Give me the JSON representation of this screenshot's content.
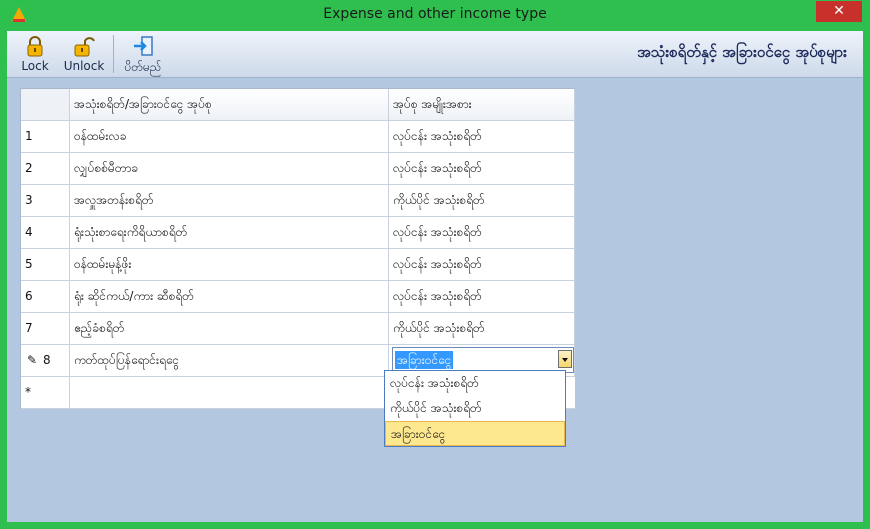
{
  "window": {
    "title": "Expense and other income type",
    "close_glyph": "✕"
  },
  "toolbar": {
    "lock_label": "Lock",
    "unlock_label": "Unlock",
    "close_label": "ပိတ်မည်"
  },
  "page_title": "အသုံးစရိတ်နှင့် အခြားဝင်ငွေ အုပ်စုများ",
  "grid": {
    "columns": [
      "အသုံးစရိတ်/အခြားဝင်ငွေ အုပ်စု",
      "အုပ်စု အမျိုးအစား"
    ],
    "rows": [
      {
        "no": "1",
        "name": "ဝန်ထမ်းလခ",
        "type": "လုပ်ငန်း အသုံးစရိတ်"
      },
      {
        "no": "2",
        "name": "လျှပ်စစ်မီတာခ",
        "type": "လုပ်ငန်း အသုံးစရိတ်"
      },
      {
        "no": "3",
        "name": "အလှူအတန်းစရိတ်",
        "type": "ကိုယ်ပိုင် အသုံးစရိတ်"
      },
      {
        "no": "4",
        "name": "ရုံးသုံးစာရေးကိရိယာစရိတ်",
        "type": "လုပ်ငန်း အသုံးစရိတ်"
      },
      {
        "no": "5",
        "name": "ဝန်ထမ်းမုန့်ဖိုး",
        "type": "လုပ်ငန်း အသုံးစရိတ်"
      },
      {
        "no": "6",
        "name": "ရုံး ဆိုင်ကယ်/ကား ဆီစရိတ်",
        "type": "လုပ်ငန်း အသုံးစရိတ်"
      },
      {
        "no": "7",
        "name": "ဧည့်ခံစရိတ်",
        "type": "ကိုယ်ပိုင် အသုံးစရိတ်"
      }
    ],
    "editing_row": {
      "no": "8",
      "name": "ကတ်ထုပ်ပြန်ရောင်းရငွေ",
      "type": "အခြားဝင်ငွေ"
    },
    "new_row_marker": "*",
    "edit_marker": "✎"
  },
  "dropdown": {
    "options": [
      "လုပ်ငန်း အသုံးစရိတ်",
      "ကိုယ်ပိုင် အသုံးစရိတ်",
      "အခြားဝင်ငွေ"
    ],
    "selected_index": 2
  },
  "colors": {
    "frame": "#2fbf4f",
    "close": "#c7302b",
    "client": "#b4c7e0",
    "selection": "#3399ff",
    "highlight": "#fde78f"
  }
}
